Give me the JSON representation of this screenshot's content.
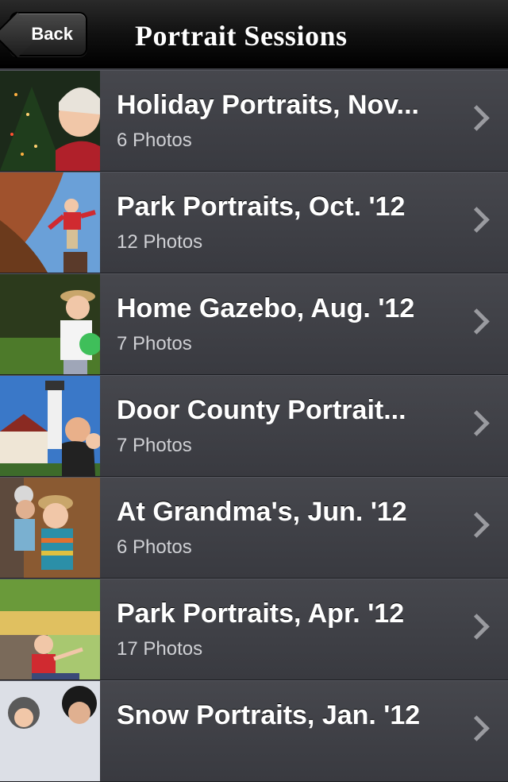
{
  "nav": {
    "back_label": "Back",
    "title": "Portrait Sessions"
  },
  "sessions": [
    {
      "title": "Holiday Portraits, Nov...",
      "count": "6 Photos"
    },
    {
      "title": "Park Portraits, Oct. '12",
      "count": "12 Photos"
    },
    {
      "title": "Home Gazebo, Aug. '12",
      "count": "7 Photos"
    },
    {
      "title": "Door County Portrait...",
      "count": "7 Photos"
    },
    {
      "title": "At Grandma's, Jun. '12",
      "count": "6 Photos"
    },
    {
      "title": "Park Portraits, Apr. '12",
      "count": "17 Photos"
    },
    {
      "title": "Snow Portraits, Jan. '12",
      "count": ""
    }
  ]
}
